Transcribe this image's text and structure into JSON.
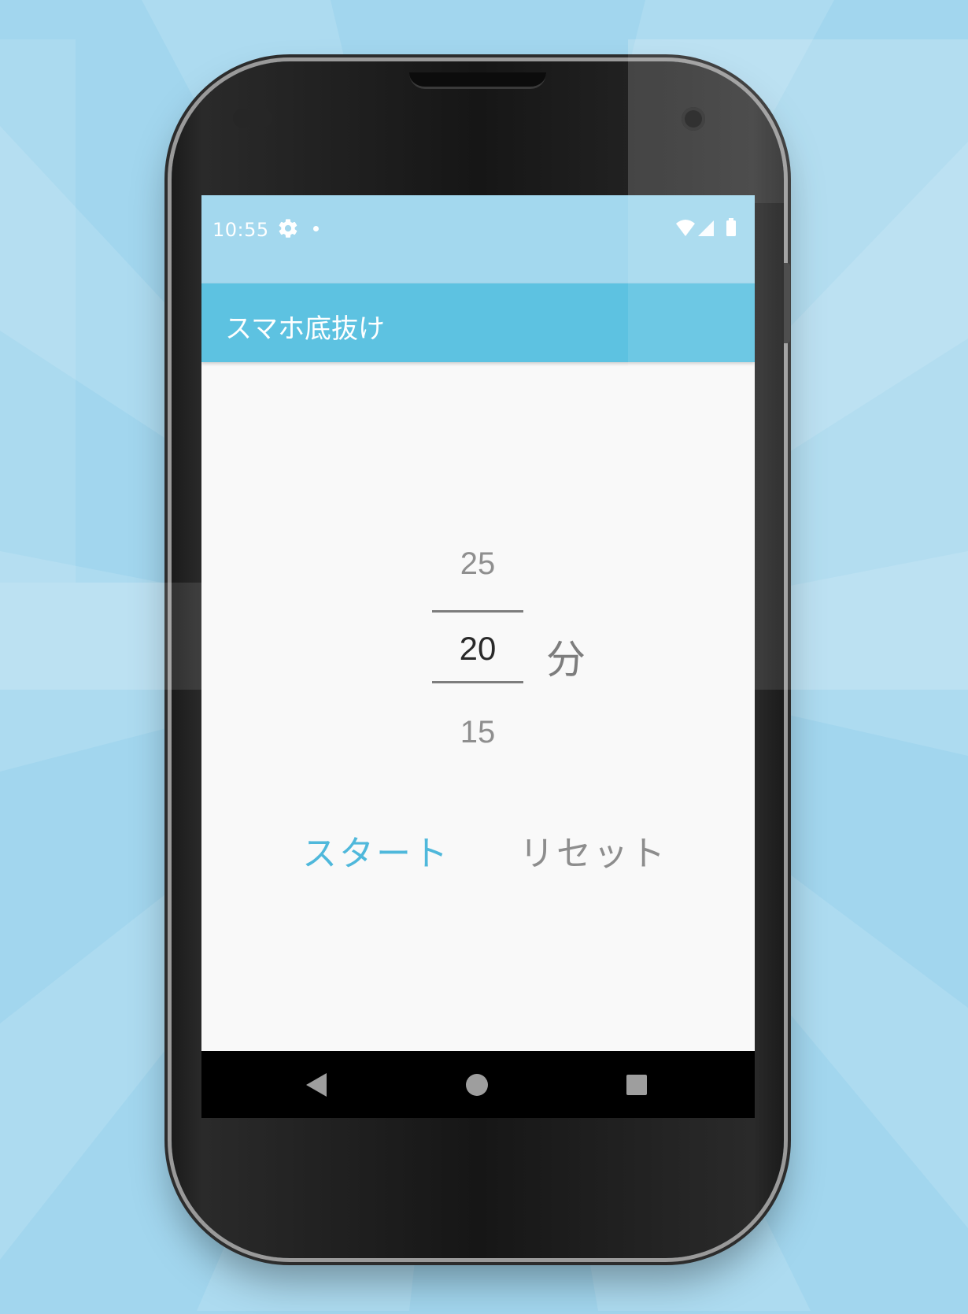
{
  "status_bar": {
    "time": "10:55",
    "icons": [
      "gear-icon",
      "notification-dot-icon",
      "wifi-icon",
      "signal-icon",
      "battery-icon"
    ]
  },
  "app_bar": {
    "title": "スマホ底抜け"
  },
  "picker": {
    "previous": "25",
    "current": "20",
    "next": "15",
    "unit": "分"
  },
  "buttons": {
    "start_label": "スタート",
    "reset_label": "リセット"
  },
  "colors": {
    "background": "#a2d6ee",
    "status_bar": "#a3d8ee",
    "app_bar": "#5dc2e1",
    "accent": "#4fb8db",
    "screen": "#f9f9f9"
  },
  "nav_bar": {
    "icons": [
      "back-icon",
      "home-icon",
      "recents-icon"
    ]
  }
}
